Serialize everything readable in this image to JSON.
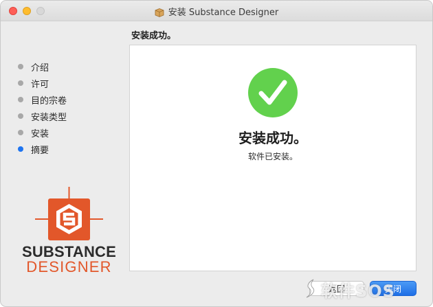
{
  "window": {
    "title": "安装 Substance Designer"
  },
  "page": {
    "heading": "安装成功。"
  },
  "steps": [
    {
      "label": "介绍",
      "active": false
    },
    {
      "label": "许可",
      "active": false
    },
    {
      "label": "目的宗卷",
      "active": false
    },
    {
      "label": "安装类型",
      "active": false
    },
    {
      "label": "安装",
      "active": false
    },
    {
      "label": "摘要",
      "active": true
    }
  ],
  "logo": {
    "line1": "SUBSTANCE",
    "line2": "DESIGNER"
  },
  "content": {
    "title": "安装成功。",
    "subtitle": "软件已安装。"
  },
  "buttons": {
    "back": "返回",
    "close": "关闭"
  },
  "watermark": {
    "text": "软件SOS"
  },
  "colors": {
    "success_green": "#62d14d",
    "brand_orange": "#e2572a",
    "accent_blue": "#1e74f0"
  }
}
